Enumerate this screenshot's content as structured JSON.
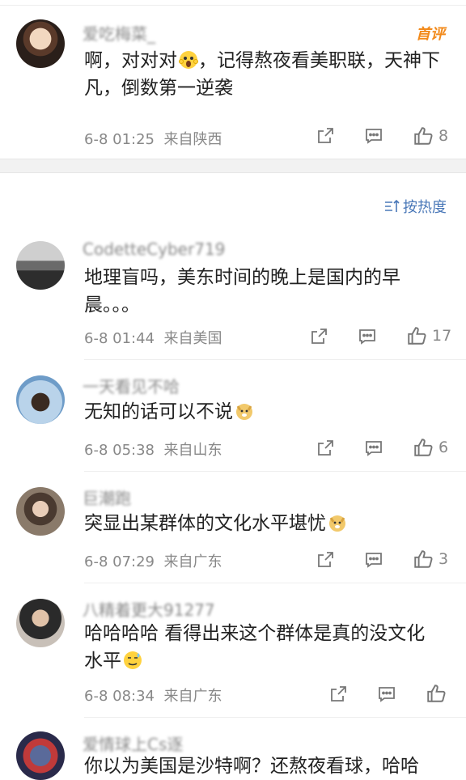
{
  "top_comment": {
    "username": "爱吃梅菜_",
    "badge": "首评",
    "text": "啊，对对对",
    "text2": "，记得熬夜看美职联，天神下凡，倒数第一逆袭",
    "time": "6-8 01:25",
    "location": "来自陕西",
    "likes": "8"
  },
  "sort_label": "按热度",
  "comments": [
    {
      "username": "CodetteCyber719",
      "text": "地理盲吗，美东时间的晚上是国内的早晨。。。",
      "time": "6-8 01:44",
      "location": "来自美国",
      "likes": "17"
    },
    {
      "username": "一天看见不哈",
      "text": "无知的话可以不说",
      "time": "6-8 05:38",
      "location": "来自山东",
      "likes": "6"
    },
    {
      "username": "巨潮跑",
      "text": "突显出某群体的文化水平堪忧",
      "time": "6-8 07:29",
      "location": "来自广东",
      "likes": "3"
    },
    {
      "username": "八精着更大91277",
      "text": "哈哈哈哈 看得出来这个群体是真的没文化水平",
      "time": "6-8 08:34",
      "location": "来自广东",
      "likes": ""
    },
    {
      "username": "爱情球上Cs逐",
      "text": "你以为美国是沙特啊？还熬夜看球，哈哈"
    }
  ]
}
